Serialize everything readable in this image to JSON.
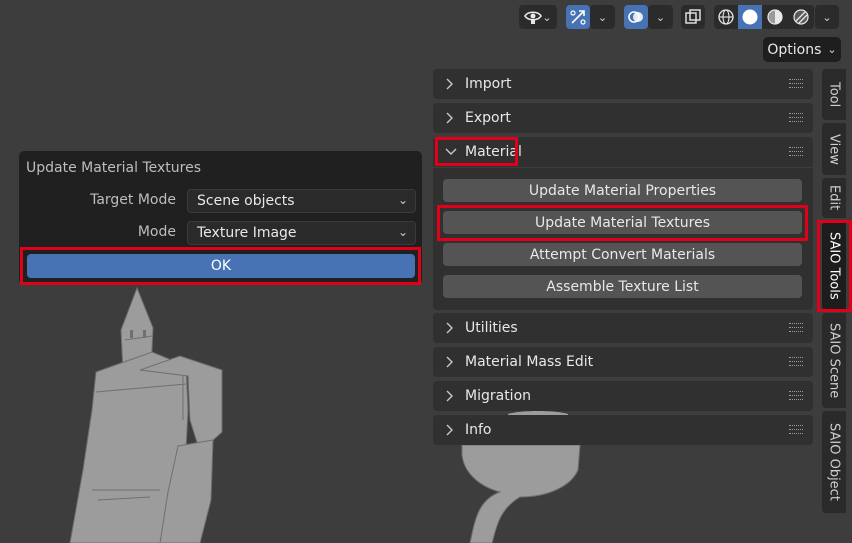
{
  "viewport": {
    "header": {
      "options_label": "Options"
    },
    "redo_panel": {
      "title": "Update Material Textures",
      "target_mode_label": "Target Mode",
      "target_mode_value": "Scene objects",
      "mode_label": "Mode",
      "mode_value": "Texture Image",
      "ok_label": "OK"
    },
    "sidebar": {
      "panels": [
        {
          "label": "Import",
          "expanded": false
        },
        {
          "label": "Export",
          "expanded": false
        },
        {
          "label": "Material",
          "expanded": true
        },
        {
          "label": "Utilities",
          "expanded": false
        },
        {
          "label": "Material Mass Edit",
          "expanded": false
        },
        {
          "label": "Migration",
          "expanded": false
        },
        {
          "label": "Info",
          "expanded": false
        }
      ],
      "material_buttons": [
        "Update Material Properties",
        "Update Material Textures",
        "Attempt Convert Materials",
        "Assemble Texture List"
      ],
      "tabs": [
        "Tool",
        "View",
        "Edit",
        "SAIO Tools",
        "SAIO Scene",
        "SAIO Object"
      ],
      "active_tab": "SAIO Tools"
    },
    "colors": {
      "accent": "#4772b3",
      "highlight": "#e0001a",
      "background": "#3d3d3d"
    }
  }
}
